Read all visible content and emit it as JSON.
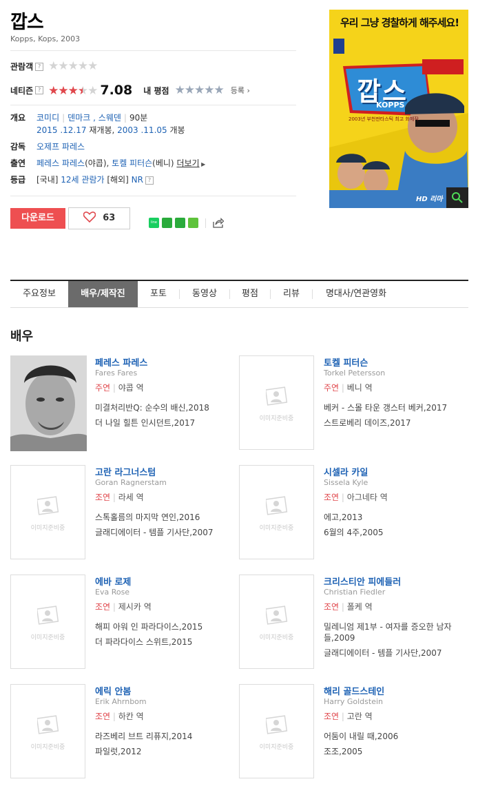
{
  "movie": {
    "title": "깝스",
    "subtitle": "Kopps, Kops, 2003"
  },
  "ratings": {
    "audience_label": "관람객",
    "netizen_label": "네티즌",
    "netizen_score": "7.08",
    "netizen_score_value": 7.08,
    "my_rating_label": "내 평점",
    "register_label": "등록",
    "audience_stars": "★★★★★",
    "netizen_stars_filled": "★★★",
    "netizen_stars_half": "★",
    "netizen_stars_empty": "★",
    "my_stars": "★★★★★"
  },
  "info": {
    "overview_label": "개요",
    "genres": [
      "코미디",
      "덴마크",
      "스웨덴"
    ],
    "runtime": "90분",
    "rerelease_date": "2015 .12.17",
    "rerelease_text": "재개봉,",
    "release_date": "2003 .11.05",
    "release_text": "개봉",
    "director_label": "감독",
    "director": "오제프 파레스",
    "cast_label": "출연",
    "cast_1": "페레스 파레스",
    "cast_1_role": "(야콥),",
    "cast_2": "토켈 피터슨",
    "cast_2_role": "(베니)",
    "more_label": "더보기",
    "grade_label": "등급",
    "grade_domestic_prefix": "[국내]",
    "grade_domestic": "12세 관람가",
    "grade_foreign_prefix": "[해외]",
    "grade_foreign": "NR"
  },
  "actions": {
    "download_label": "다운로드",
    "like_count": "63",
    "colors": {
      "download": "#ee4f51",
      "line": "#19ce60",
      "band": "#2aab3b",
      "green_sq": "#5ec33b"
    }
  },
  "poster": {
    "headline": "우리 그냥 경찰하게 해주세요!",
    "logo_text": "깝스",
    "logo_en": "KOPPS",
    "sticker": "HD 리마",
    "tagline": "2003년 부천판타스틱 최고 화제작"
  },
  "tabs": [
    "주요정보",
    "배우/제작진",
    "포토",
    "동영상",
    "평점",
    "리뷰",
    "명대사/연관영화"
  ],
  "active_tab": "배우/제작진",
  "section_title": "배우",
  "placeholder_text": "이미지준비중",
  "actors": [
    {
      "name": "페레스 파레스",
      "en": "Fares Fares",
      "type": "주연",
      "role": "야콥 역",
      "works": [
        "미결처리반Q: 순수의 배신,2018",
        "더 나일 힐튼 인시던트,2017"
      ],
      "has_photo": true
    },
    {
      "name": "토켈 피터슨",
      "en": "Torkel Petersson",
      "type": "주연",
      "role": "베니 역",
      "works": [
        "베커 - 스몰 타운 갱스터 베커,2017",
        "스트로베리 데이즈,2017"
      ],
      "has_photo": false
    },
    {
      "name": "고란 라그너스텀",
      "en": "Goran Ragnerstam",
      "type": "조연",
      "role": "라세 역",
      "works": [
        "스톡홀름의 마지막 연인,2016",
        "글래디에이터 - 템플 기사단,2007"
      ],
      "has_photo": false
    },
    {
      "name": "시셀라 카일",
      "en": "Sissela Kyle",
      "type": "조연",
      "role": "아그네타 역",
      "works": [
        "에고,2013",
        "6월의 4주,2005"
      ],
      "has_photo": false
    },
    {
      "name": "에바 로제",
      "en": "Eva Rose",
      "type": "조연",
      "role": "제시카 역",
      "works": [
        "해피 아워 인 파라다이스,2015",
        "더 파라다이스 스위트,2015"
      ],
      "has_photo": false
    },
    {
      "name": "크리스티안 피에들러",
      "en": "Christian Fiedler",
      "type": "조연",
      "role": "폴케 역",
      "works": [
        "밀레니엄 제1부 - 여자를 증오한 남자들,2009",
        "글래디에이터 - 템플 기사단,2007"
      ],
      "has_photo": false
    },
    {
      "name": "에릭 안봄",
      "en": "Erik Ahrnbom",
      "type": "조연",
      "role": "하칸 역",
      "works": [
        "라즈베리 브트 리퓨지,2014",
        "파일럿,2012"
      ],
      "has_photo": false
    },
    {
      "name": "해리 골드스테인",
      "en": "Harry Goldstein",
      "type": "조연",
      "role": "고란 역",
      "works": [
        "어둠이 내릴 때,2006",
        "조조,2005"
      ],
      "has_photo": false
    }
  ]
}
